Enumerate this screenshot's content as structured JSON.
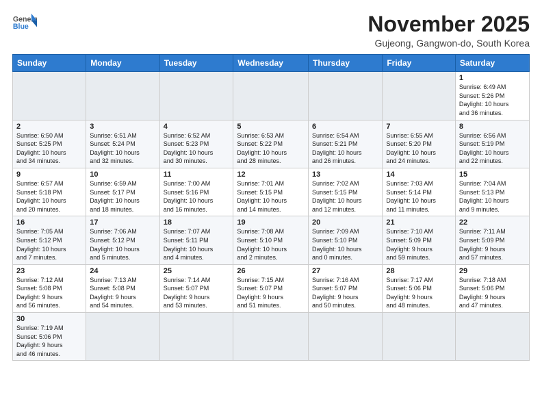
{
  "logo": {
    "line1": "General",
    "line2": "Blue"
  },
  "title": "November 2025",
  "location": "Gujeong, Gangwon-do, South Korea",
  "weekdays": [
    "Sunday",
    "Monday",
    "Tuesday",
    "Wednesday",
    "Thursday",
    "Friday",
    "Saturday"
  ],
  "weeks": [
    [
      {
        "day": "",
        "info": ""
      },
      {
        "day": "",
        "info": ""
      },
      {
        "day": "",
        "info": ""
      },
      {
        "day": "",
        "info": ""
      },
      {
        "day": "",
        "info": ""
      },
      {
        "day": "",
        "info": ""
      },
      {
        "day": "1",
        "info": "Sunrise: 6:49 AM\nSunset: 5:26 PM\nDaylight: 10 hours\nand 36 minutes."
      }
    ],
    [
      {
        "day": "2",
        "info": "Sunrise: 6:50 AM\nSunset: 5:25 PM\nDaylight: 10 hours\nand 34 minutes."
      },
      {
        "day": "3",
        "info": "Sunrise: 6:51 AM\nSunset: 5:24 PM\nDaylight: 10 hours\nand 32 minutes."
      },
      {
        "day": "4",
        "info": "Sunrise: 6:52 AM\nSunset: 5:23 PM\nDaylight: 10 hours\nand 30 minutes."
      },
      {
        "day": "5",
        "info": "Sunrise: 6:53 AM\nSunset: 5:22 PM\nDaylight: 10 hours\nand 28 minutes."
      },
      {
        "day": "6",
        "info": "Sunrise: 6:54 AM\nSunset: 5:21 PM\nDaylight: 10 hours\nand 26 minutes."
      },
      {
        "day": "7",
        "info": "Sunrise: 6:55 AM\nSunset: 5:20 PM\nDaylight: 10 hours\nand 24 minutes."
      },
      {
        "day": "8",
        "info": "Sunrise: 6:56 AM\nSunset: 5:19 PM\nDaylight: 10 hours\nand 22 minutes."
      }
    ],
    [
      {
        "day": "9",
        "info": "Sunrise: 6:57 AM\nSunset: 5:18 PM\nDaylight: 10 hours\nand 20 minutes."
      },
      {
        "day": "10",
        "info": "Sunrise: 6:59 AM\nSunset: 5:17 PM\nDaylight: 10 hours\nand 18 minutes."
      },
      {
        "day": "11",
        "info": "Sunrise: 7:00 AM\nSunset: 5:16 PM\nDaylight: 10 hours\nand 16 minutes."
      },
      {
        "day": "12",
        "info": "Sunrise: 7:01 AM\nSunset: 5:15 PM\nDaylight: 10 hours\nand 14 minutes."
      },
      {
        "day": "13",
        "info": "Sunrise: 7:02 AM\nSunset: 5:15 PM\nDaylight: 10 hours\nand 12 minutes."
      },
      {
        "day": "14",
        "info": "Sunrise: 7:03 AM\nSunset: 5:14 PM\nDaylight: 10 hours\nand 11 minutes."
      },
      {
        "day": "15",
        "info": "Sunrise: 7:04 AM\nSunset: 5:13 PM\nDaylight: 10 hours\nand 9 minutes."
      }
    ],
    [
      {
        "day": "16",
        "info": "Sunrise: 7:05 AM\nSunset: 5:12 PM\nDaylight: 10 hours\nand 7 minutes."
      },
      {
        "day": "17",
        "info": "Sunrise: 7:06 AM\nSunset: 5:12 PM\nDaylight: 10 hours\nand 5 minutes."
      },
      {
        "day": "18",
        "info": "Sunrise: 7:07 AM\nSunset: 5:11 PM\nDaylight: 10 hours\nand 4 minutes."
      },
      {
        "day": "19",
        "info": "Sunrise: 7:08 AM\nSunset: 5:10 PM\nDaylight: 10 hours\nand 2 minutes."
      },
      {
        "day": "20",
        "info": "Sunrise: 7:09 AM\nSunset: 5:10 PM\nDaylight: 10 hours\nand 0 minutes."
      },
      {
        "day": "21",
        "info": "Sunrise: 7:10 AM\nSunset: 5:09 PM\nDaylight: 9 hours\nand 59 minutes."
      },
      {
        "day": "22",
        "info": "Sunrise: 7:11 AM\nSunset: 5:09 PM\nDaylight: 9 hours\nand 57 minutes."
      }
    ],
    [
      {
        "day": "23",
        "info": "Sunrise: 7:12 AM\nSunset: 5:08 PM\nDaylight: 9 hours\nand 56 minutes."
      },
      {
        "day": "24",
        "info": "Sunrise: 7:13 AM\nSunset: 5:08 PM\nDaylight: 9 hours\nand 54 minutes."
      },
      {
        "day": "25",
        "info": "Sunrise: 7:14 AM\nSunset: 5:07 PM\nDaylight: 9 hours\nand 53 minutes."
      },
      {
        "day": "26",
        "info": "Sunrise: 7:15 AM\nSunset: 5:07 PM\nDaylight: 9 hours\nand 51 minutes."
      },
      {
        "day": "27",
        "info": "Sunrise: 7:16 AM\nSunset: 5:07 PM\nDaylight: 9 hours\nand 50 minutes."
      },
      {
        "day": "28",
        "info": "Sunrise: 7:17 AM\nSunset: 5:06 PM\nDaylight: 9 hours\nand 48 minutes."
      },
      {
        "day": "29",
        "info": "Sunrise: 7:18 AM\nSunset: 5:06 PM\nDaylight: 9 hours\nand 47 minutes."
      }
    ],
    [
      {
        "day": "30",
        "info": "Sunrise: 7:19 AM\nSunset: 5:06 PM\nDaylight: 9 hours\nand 46 minutes."
      },
      {
        "day": "",
        "info": ""
      },
      {
        "day": "",
        "info": ""
      },
      {
        "day": "",
        "info": ""
      },
      {
        "day": "",
        "info": ""
      },
      {
        "day": "",
        "info": ""
      },
      {
        "day": "",
        "info": ""
      }
    ]
  ]
}
